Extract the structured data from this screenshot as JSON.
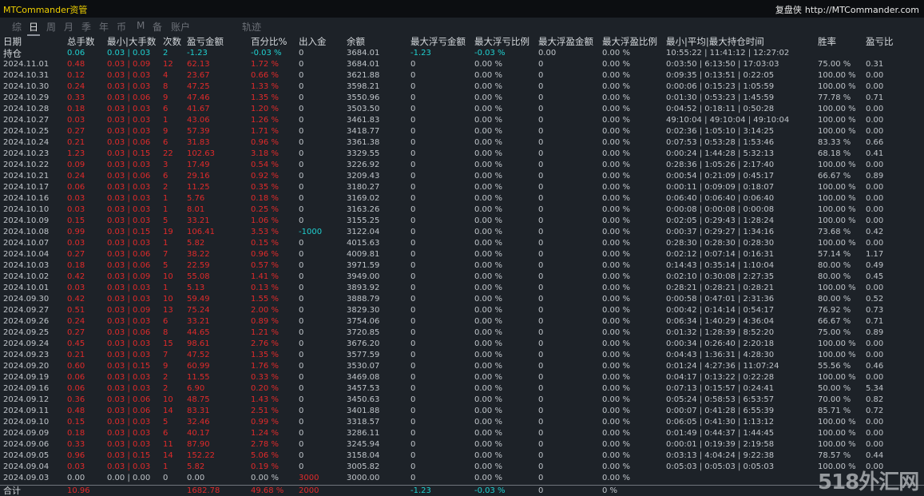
{
  "app": {
    "title": "MTCommander资管",
    "right_label": "复盘侠",
    "url": "http://MTCommander.com"
  },
  "tabs": [
    {
      "label": "综",
      "active": false
    },
    {
      "label": "日",
      "active": true
    },
    {
      "label": "周",
      "active": false
    },
    {
      "label": "月",
      "active": false
    },
    {
      "label": "季",
      "active": false
    },
    {
      "label": "年",
      "active": false
    },
    {
      "label": "币",
      "active": false
    },
    {
      "label": "M",
      "active": false
    },
    {
      "label": "备",
      "active": false
    },
    {
      "label": "账户",
      "active": false
    },
    {
      "label": "轨迹",
      "active": false
    }
  ],
  "headers": [
    "日期",
    "总手数",
    "最小|大手数",
    "次数",
    "盈亏金额",
    "百分比%",
    "出入金",
    "余额",
    "最大浮亏金额",
    "最大浮亏比例",
    "最大浮盈金额",
    "最大浮盈比例",
    "最小|平均|最大持仓时间",
    "胜率",
    "盈亏比"
  ],
  "holding": [
    "持仓",
    "0.06",
    "0.03 | 0.03",
    "2",
    "-1.23",
    "-0.03 %",
    "0",
    "3684.01",
    "-1.23",
    "-0.03 %",
    "0.00",
    "0.00 %",
    "10:55:22 | 11:41:12 | 12:27:02",
    "",
    ""
  ],
  "rows": [
    [
      "2024.11.01",
      "0.48",
      "0.03 | 0.09",
      "12",
      "62.13",
      "1.72 %",
      "0",
      "3684.01",
      "0",
      "0.00 %",
      "0",
      "0.00 %",
      "0:03:50 | 6:13:50 | 17:03:03",
      "75.00 %",
      "0.31"
    ],
    [
      "2024.10.31",
      "0.12",
      "0.03 | 0.03",
      "4",
      "23.67",
      "0.66 %",
      "0",
      "3621.88",
      "0",
      "0.00 %",
      "0",
      "0.00 %",
      "0:09:35 | 0:13:51 | 0:22:05",
      "100.00 %",
      "0.00"
    ],
    [
      "2024.10.30",
      "0.24",
      "0.03 | 0.03",
      "8",
      "47.25",
      "1.33 %",
      "0",
      "3598.21",
      "0",
      "0.00 %",
      "0",
      "0.00 %",
      "0:00:06 | 0:15:23 | 1:05:59",
      "100.00 %",
      "0.00"
    ],
    [
      "2024.10.29",
      "0.33",
      "0.03 | 0.06",
      "9",
      "47.46",
      "1.35 %",
      "0",
      "3550.96",
      "0",
      "0.00 %",
      "0",
      "0.00 %",
      "0:01:30 | 0:53:23 | 1:45:59",
      "77.78 %",
      "0.71"
    ],
    [
      "2024.10.28",
      "0.18",
      "0.03 | 0.03",
      "6",
      "41.67",
      "1.20 %",
      "0",
      "3503.50",
      "0",
      "0.00 %",
      "0",
      "0.00 %",
      "0:04:52 | 0:18:11 | 0:50:28",
      "100.00 %",
      "0.00"
    ],
    [
      "2024.10.27",
      "0.03",
      "0.03 | 0.03",
      "1",
      "43.06",
      "1.26 %",
      "0",
      "3461.83",
      "0",
      "0.00 %",
      "0",
      "0.00 %",
      "49:10:04 | 49:10:04 | 49:10:04",
      "100.00 %",
      "0.00"
    ],
    [
      "2024.10.25",
      "0.27",
      "0.03 | 0.03",
      "9",
      "57.39",
      "1.71 %",
      "0",
      "3418.77",
      "0",
      "0.00 %",
      "0",
      "0.00 %",
      "0:02:36 | 1:05:10 | 3:14:25",
      "100.00 %",
      "0.00"
    ],
    [
      "2024.10.24",
      "0.21",
      "0.03 | 0.06",
      "6",
      "31.83",
      "0.96 %",
      "0",
      "3361.38",
      "0",
      "0.00 %",
      "0",
      "0.00 %",
      "0:07:53 | 0:53:28 | 1:53:46",
      "83.33 %",
      "0.66"
    ],
    [
      "2024.10.23",
      "1.23",
      "0.03 | 0.15",
      "22",
      "102.63",
      "3.18 %",
      "0",
      "3329.55",
      "0",
      "0.00 %",
      "0",
      "0.00 %",
      "0:00:24 | 1:44:28 | 5:32:13",
      "68.18 %",
      "0.41"
    ],
    [
      "2024.10.22",
      "0.09",
      "0.03 | 0.03",
      "3",
      "17.49",
      "0.54 %",
      "0",
      "3226.92",
      "0",
      "0.00 %",
      "0",
      "0.00 %",
      "0:28:36 | 1:05:26 | 2:17:40",
      "100.00 %",
      "0.00"
    ],
    [
      "2024.10.21",
      "0.24",
      "0.03 | 0.06",
      "6",
      "29.16",
      "0.92 %",
      "0",
      "3209.43",
      "0",
      "0.00 %",
      "0",
      "0.00 %",
      "0:00:54 | 0:21:09 | 0:45:17",
      "66.67 %",
      "0.89"
    ],
    [
      "2024.10.17",
      "0.06",
      "0.03 | 0.03",
      "2",
      "11.25",
      "0.35 %",
      "0",
      "3180.27",
      "0",
      "0.00 %",
      "0",
      "0.00 %",
      "0:00:11 | 0:09:09 | 0:18:07",
      "100.00 %",
      "0.00"
    ],
    [
      "2024.10.16",
      "0.03",
      "0.03 | 0.03",
      "1",
      "5.76",
      "0.18 %",
      "0",
      "3169.02",
      "0",
      "0.00 %",
      "0",
      "0.00 %",
      "0:06:40 | 0:06:40 | 0:06:40",
      "100.00 %",
      "0.00"
    ],
    [
      "2024.10.10",
      "0.03",
      "0.03 | 0.03",
      "1",
      "8.01",
      "0.25 %",
      "0",
      "3163.26",
      "0",
      "0.00 %",
      "0",
      "0.00 %",
      "0:00:08 | 0:00:08 | 0:00:08",
      "100.00 %",
      "0.00"
    ],
    [
      "2024.10.09",
      "0.15",
      "0.03 | 0.03",
      "5",
      "33.21",
      "1.06 %",
      "0",
      "3155.25",
      "0",
      "0.00 %",
      "0",
      "0.00 %",
      "0:02:05 | 0:29:43 | 1:28:24",
      "100.00 %",
      "0.00"
    ],
    [
      "2024.10.08",
      "0.99",
      "0.03 | 0.15",
      "19",
      "106.41",
      "3.53 %",
      "-1000",
      "3122.04",
      "0",
      "0.00 %",
      "0",
      "0.00 %",
      "0:00:37 | 0:29:27 | 1:34:16",
      "73.68 %",
      "0.42"
    ],
    [
      "2024.10.07",
      "0.03",
      "0.03 | 0.03",
      "1",
      "5.82",
      "0.15 %",
      "0",
      "4015.63",
      "0",
      "0.00 %",
      "0",
      "0.00 %",
      "0:28:30 | 0:28:30 | 0:28:30",
      "100.00 %",
      "0.00"
    ],
    [
      "2024.10.04",
      "0.27",
      "0.03 | 0.06",
      "7",
      "38.22",
      "0.96 %",
      "0",
      "4009.81",
      "0",
      "0.00 %",
      "0",
      "0.00 %",
      "0:02:12 | 0:07:14 | 0:16:31",
      "57.14 %",
      "1.17"
    ],
    [
      "2024.10.03",
      "0.18",
      "0.03 | 0.06",
      "5",
      "22.59",
      "0.57 %",
      "0",
      "3971.59",
      "0",
      "0.00 %",
      "0",
      "0.00 %",
      "0:14:43 | 0:35:14 | 1:10:04",
      "80.00 %",
      "0.49"
    ],
    [
      "2024.10.02",
      "0.42",
      "0.03 | 0.09",
      "10",
      "55.08",
      "1.41 %",
      "0",
      "3949.00",
      "0",
      "0.00 %",
      "0",
      "0.00 %",
      "0:02:10 | 0:30:08 | 2:27:35",
      "80.00 %",
      "0.45"
    ],
    [
      "2024.10.01",
      "0.03",
      "0.03 | 0.03",
      "1",
      "5.13",
      "0.13 %",
      "0",
      "3893.92",
      "0",
      "0.00 %",
      "0",
      "0.00 %",
      "0:28:21 | 0:28:21 | 0:28:21",
      "100.00 %",
      "0.00"
    ],
    [
      "2024.09.30",
      "0.42",
      "0.03 | 0.03",
      "10",
      "59.49",
      "1.55 %",
      "0",
      "3888.79",
      "0",
      "0.00 %",
      "0",
      "0.00 %",
      "0:00:58 | 0:47:01 | 2:31:36",
      "80.00 %",
      "0.52"
    ],
    [
      "2024.09.27",
      "0.51",
      "0.03 | 0.09",
      "13",
      "75.24",
      "2.00 %",
      "0",
      "3829.30",
      "0",
      "0.00 %",
      "0",
      "0.00 %",
      "0:00:42 | 0:14:14 | 0:54:17",
      "76.92 %",
      "0.73"
    ],
    [
      "2024.09.26",
      "0.24",
      "0.03 | 0.03",
      "6",
      "33.21",
      "0.89 %",
      "0",
      "3754.06",
      "0",
      "0.00 %",
      "0",
      "0.00 %",
      "0:06:34 | 1:40:29 | 4:36:04",
      "66.67 %",
      "0.71"
    ],
    [
      "2024.09.25",
      "0.27",
      "0.03 | 0.06",
      "8",
      "44.65",
      "1.21 %",
      "0",
      "3720.85",
      "0",
      "0.00 %",
      "0",
      "0.00 %",
      "0:01:32 | 1:28:39 | 8:52:20",
      "75.00 %",
      "0.89"
    ],
    [
      "2024.09.24",
      "0.45",
      "0.03 | 0.03",
      "15",
      "98.61",
      "2.76 %",
      "0",
      "3676.20",
      "0",
      "0.00 %",
      "0",
      "0.00 %",
      "0:00:34 | 0:26:40 | 2:20:18",
      "100.00 %",
      "0.00"
    ],
    [
      "2024.09.23",
      "0.21",
      "0.03 | 0.03",
      "7",
      "47.52",
      "1.35 %",
      "0",
      "3577.59",
      "0",
      "0.00 %",
      "0",
      "0.00 %",
      "0:04:43 | 1:36:31 | 4:28:30",
      "100.00 %",
      "0.00"
    ],
    [
      "2024.09.20",
      "0.60",
      "0.03 | 0.15",
      "9",
      "60.99",
      "1.76 %",
      "0",
      "3530.07",
      "0",
      "0.00 %",
      "0",
      "0.00 %",
      "0:01:24 | 4:27:36 | 11:07:24",
      "55.56 %",
      "0.46"
    ],
    [
      "2024.09.19",
      "0.06",
      "0.03 | 0.03",
      "2",
      "11.55",
      "0.33 %",
      "0",
      "3469.08",
      "0",
      "0.00 %",
      "0",
      "0.00 %",
      "0:04:17 | 0:13:22 | 0:22:28",
      "100.00 %",
      "0.00"
    ],
    [
      "2024.09.16",
      "0.06",
      "0.03 | 0.03",
      "2",
      "6.90",
      "0.20 %",
      "0",
      "3457.53",
      "0",
      "0.00 %",
      "0",
      "0.00 %",
      "0:07:13 | 0:15:57 | 0:24:41",
      "50.00 %",
      "5.34"
    ],
    [
      "2024.09.12",
      "0.36",
      "0.03 | 0.06",
      "10",
      "48.75",
      "1.43 %",
      "0",
      "3450.63",
      "0",
      "0.00 %",
      "0",
      "0.00 %",
      "0:05:24 | 0:58:53 | 6:53:57",
      "70.00 %",
      "0.82"
    ],
    [
      "2024.09.11",
      "0.48",
      "0.03 | 0.06",
      "14",
      "83.31",
      "2.51 %",
      "0",
      "3401.88",
      "0",
      "0.00 %",
      "0",
      "0.00 %",
      "0:00:07 | 0:41:28 | 6:55:39",
      "85.71 %",
      "0.72"
    ],
    [
      "2024.09.10",
      "0.15",
      "0.03 | 0.03",
      "5",
      "32.46",
      "0.99 %",
      "0",
      "3318.57",
      "0",
      "0.00 %",
      "0",
      "0.00 %",
      "0:06:05 | 0:41:30 | 1:13:12",
      "100.00 %",
      "0.00"
    ],
    [
      "2024.09.09",
      "0.18",
      "0.03 | 0.03",
      "6",
      "40.17",
      "1.24 %",
      "0",
      "3286.11",
      "0",
      "0.00 %",
      "0",
      "0.00 %",
      "0:01:49 | 0:44:37 | 1:44:45",
      "100.00 %",
      "0.00"
    ],
    [
      "2024.09.06",
      "0.33",
      "0.03 | 0.03",
      "11",
      "87.90",
      "2.78 %",
      "0",
      "3245.94",
      "0",
      "0.00 %",
      "0",
      "0.00 %",
      "0:00:01 | 0:19:39 | 2:19:58",
      "100.00 %",
      "0.00"
    ],
    [
      "2024.09.05",
      "0.96",
      "0.03 | 0.15",
      "14",
      "152.22",
      "5.06 %",
      "0",
      "3158.04",
      "0",
      "0.00 %",
      "0",
      "0.00 %",
      "0:03:13 | 4:04:24 | 9:22:38",
      "78.57 %",
      "0.44"
    ],
    [
      "2024.09.04",
      "0.03",
      "0.03 | 0.03",
      "1",
      "5.82",
      "0.19 %",
      "0",
      "3005.82",
      "0",
      "0.00 %",
      "0",
      "0.00 %",
      "0:05:03 | 0:05:03 | 0:05:03",
      "100.00 %",
      "0.00"
    ],
    [
      "2024.09.03",
      "0.00",
      "0.00 | 0.00",
      "0",
      "0.00",
      "0.00 %",
      "3000",
      "3000.00",
      "0",
      "0.00 %",
      "0",
      "0.00 %",
      "",
      "",
      ""
    ]
  ],
  "total": [
    "合计",
    "10.96",
    "",
    "",
    "1682.78",
    "49.68 %",
    "2000",
    "",
    "-1.23",
    "-0.03 %",
    "0",
    "0 %",
    "",
    "",
    ""
  ],
  "watermark": "518外汇网",
  "colors": {
    "background": "#1d2228",
    "topbar": "#0c0e11",
    "title": "#f0d000",
    "profit": "#e02a2a",
    "holding": "#1fd0d0",
    "text": "#bfc4c9"
  }
}
